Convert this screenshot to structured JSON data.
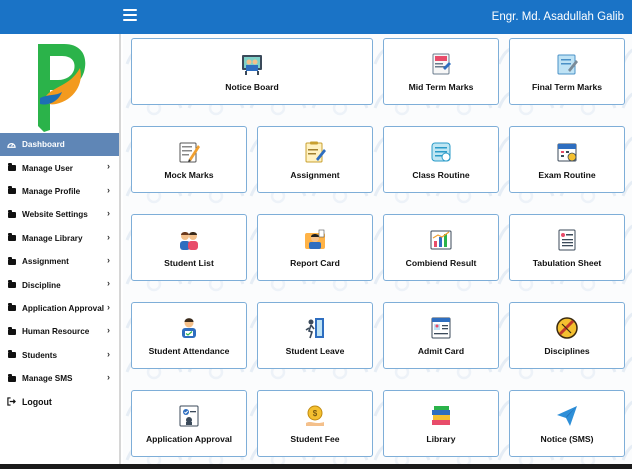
{
  "header": {
    "username": "Engr. Md. Asadullah Galib"
  },
  "colors": {
    "topbar": "#1a73c6",
    "active_nav": "#5f86b6",
    "tile_border": "#7eaed8"
  },
  "sidebar": {
    "items": [
      {
        "label": "Dashboard",
        "icon": "dashboard-icon",
        "active": true,
        "chevron": false
      },
      {
        "label": "Manage User",
        "icon": "folder-icon",
        "active": false,
        "chevron": true
      },
      {
        "label": "Manage Profile",
        "icon": "folder-icon",
        "active": false,
        "chevron": true
      },
      {
        "label": "Website Settings",
        "icon": "folder-icon",
        "active": false,
        "chevron": true
      },
      {
        "label": "Manage Library",
        "icon": "folder-icon",
        "active": false,
        "chevron": true
      },
      {
        "label": "Assignment",
        "icon": "folder-icon",
        "active": false,
        "chevron": true
      },
      {
        "label": "Discipline",
        "icon": "folder-icon",
        "active": false,
        "chevron": true
      },
      {
        "label": "Application Approval",
        "icon": "folder-icon",
        "active": false,
        "chevron": true
      },
      {
        "label": "Human Resource",
        "icon": "folder-icon",
        "active": false,
        "chevron": true
      },
      {
        "label": "Students",
        "icon": "folder-icon",
        "active": false,
        "chevron": true
      },
      {
        "label": "Manage SMS",
        "icon": "folder-icon",
        "active": false,
        "chevron": true
      }
    ],
    "logout_label": "Logout"
  },
  "tiles": [
    {
      "label": "Notice Board",
      "icon": "notice-board-icon"
    },
    {
      "label": "Mid Term Marks",
      "icon": "mid-term-marks-icon"
    },
    {
      "label": "Final Term Marks",
      "icon": "final-term-marks-icon"
    },
    {
      "label": "Mock Marks",
      "icon": "mock-marks-icon"
    },
    {
      "label": "Assignment",
      "icon": "assignment-icon"
    },
    {
      "label": "Class Routine",
      "icon": "class-routine-icon"
    },
    {
      "label": "Exam Routine",
      "icon": "exam-routine-icon"
    },
    {
      "label": "Student List",
      "icon": "student-list-icon"
    },
    {
      "label": "Report Card",
      "icon": "report-card-icon"
    },
    {
      "label": "Combiend Result",
      "icon": "combined-result-icon"
    },
    {
      "label": "Tabulation Sheet",
      "icon": "tabulation-sheet-icon"
    },
    {
      "label": "Student Attendance",
      "icon": "student-attendance-icon"
    },
    {
      "label": "Student Leave",
      "icon": "student-leave-icon"
    },
    {
      "label": "Admit Card",
      "icon": "admit-card-icon"
    },
    {
      "label": "Disciplines",
      "icon": "disciplines-icon"
    },
    {
      "label": "Application Approval",
      "icon": "application-approval-icon"
    },
    {
      "label": "Student Fee",
      "icon": "student-fee-icon"
    },
    {
      "label": "Library",
      "icon": "library-icon"
    },
    {
      "label": "Notice (SMS)",
      "icon": "notice-sms-icon"
    }
  ]
}
